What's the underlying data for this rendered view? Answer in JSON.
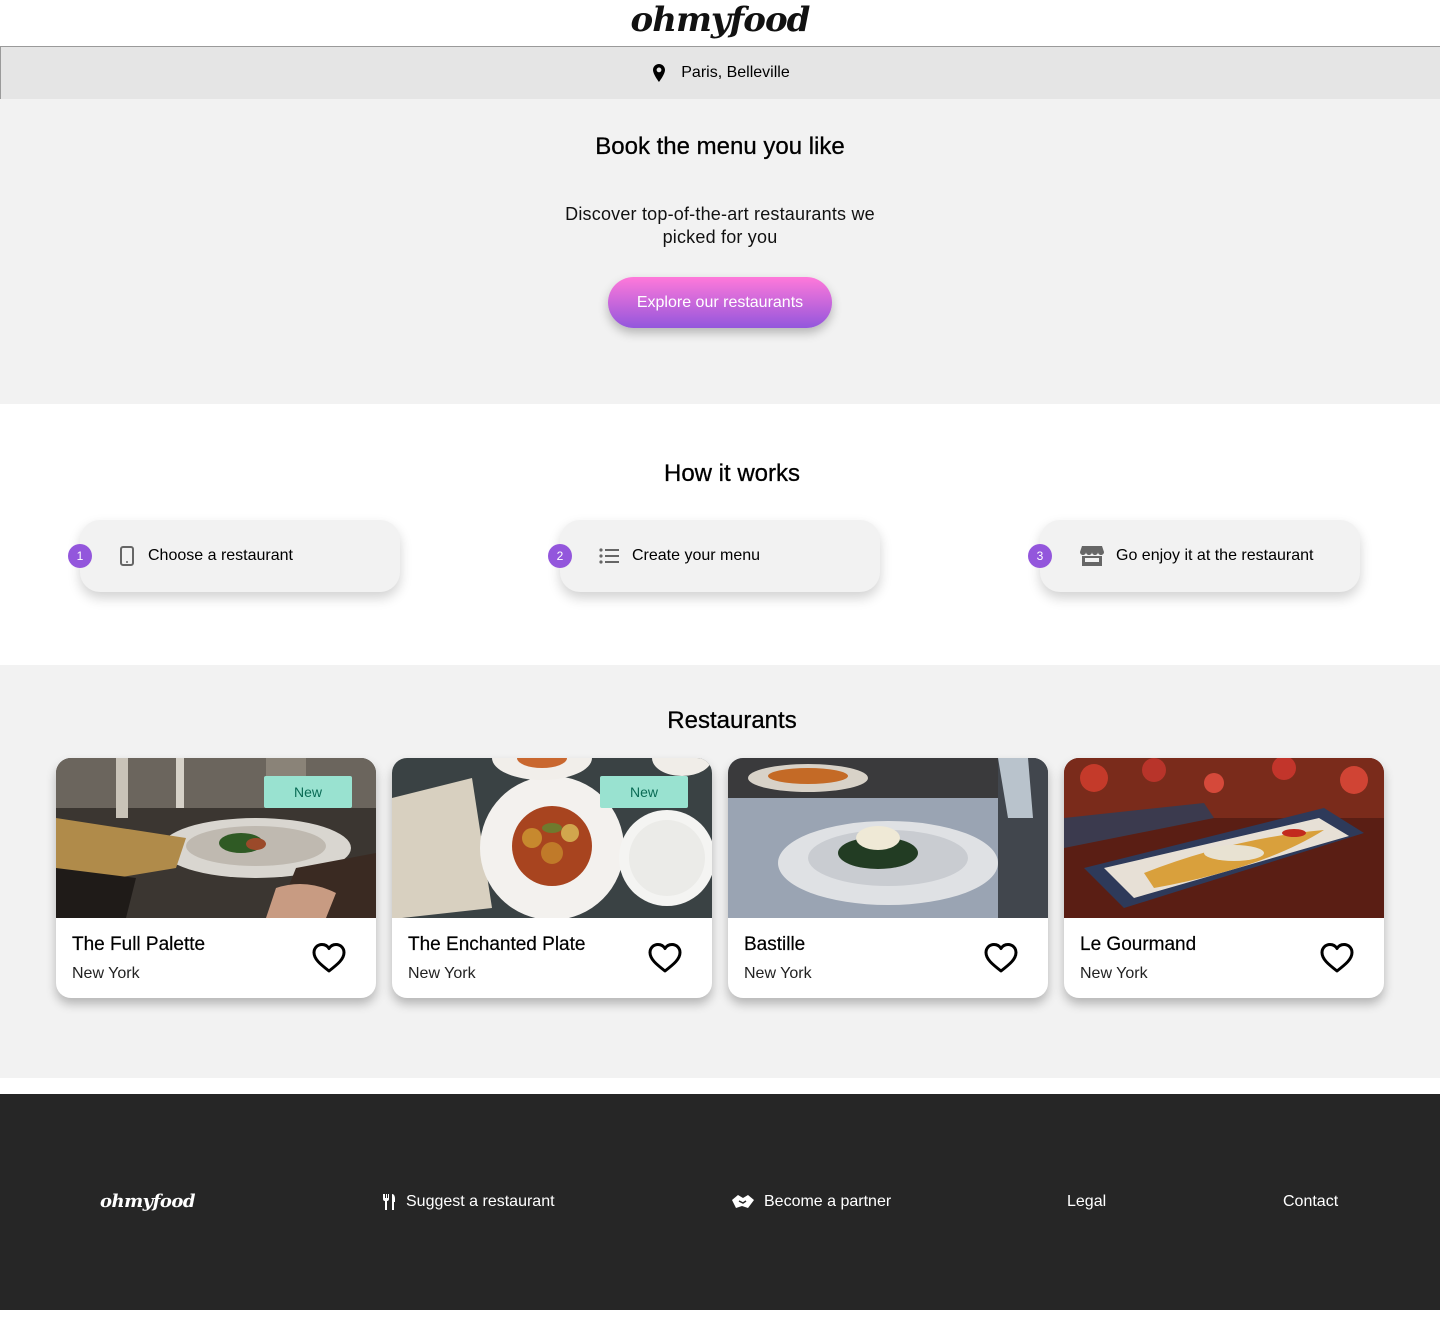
{
  "header": {
    "logo": "ohmyfood",
    "location": {
      "icon": "map-pin-icon",
      "text": "Paris, Belleville"
    }
  },
  "hero": {
    "title": "Book the menu you like",
    "subtitle": "Discover top-of-the-art restaurants we picked for you",
    "cta_label": "Explore our restaurants",
    "cta_gradient": [
      "#ff79da",
      "#9356dc"
    ]
  },
  "how_it_works": {
    "title": "How it works",
    "steps": [
      {
        "number": "1",
        "icon": "mobile-phone-icon",
        "label": "Choose a restaurant"
      },
      {
        "number": "2",
        "icon": "list-icon",
        "label": "Create your menu"
      },
      {
        "number": "3",
        "icon": "store-icon",
        "label": "Go enjoy it at the restaurant"
      }
    ],
    "accent_color": "#9356dc"
  },
  "restaurants": {
    "title": "Restaurants",
    "badge_label": "New",
    "badge_color": "#99e2d0",
    "items": [
      {
        "name": "The Full Palette",
        "city": "New York",
        "is_new": true,
        "icon": "heart-outline-icon"
      },
      {
        "name": "The Enchanted Plate",
        "city": "New York",
        "is_new": true,
        "icon": "heart-outline-icon"
      },
      {
        "name": "Bastille",
        "city": "New York",
        "is_new": false,
        "icon": "heart-outline-icon"
      },
      {
        "name": "Le Gourmand",
        "city": "New York",
        "is_new": false,
        "icon": "heart-outline-icon"
      }
    ]
  },
  "footer": {
    "logo": "ohmyfood",
    "links": [
      {
        "icon": "utensils-icon",
        "label": "Suggest a restaurant"
      },
      {
        "icon": "handshake-icon",
        "label": "Become a partner"
      },
      {
        "icon": "",
        "label": "Legal"
      },
      {
        "icon": "",
        "label": "Contact"
      }
    ]
  }
}
